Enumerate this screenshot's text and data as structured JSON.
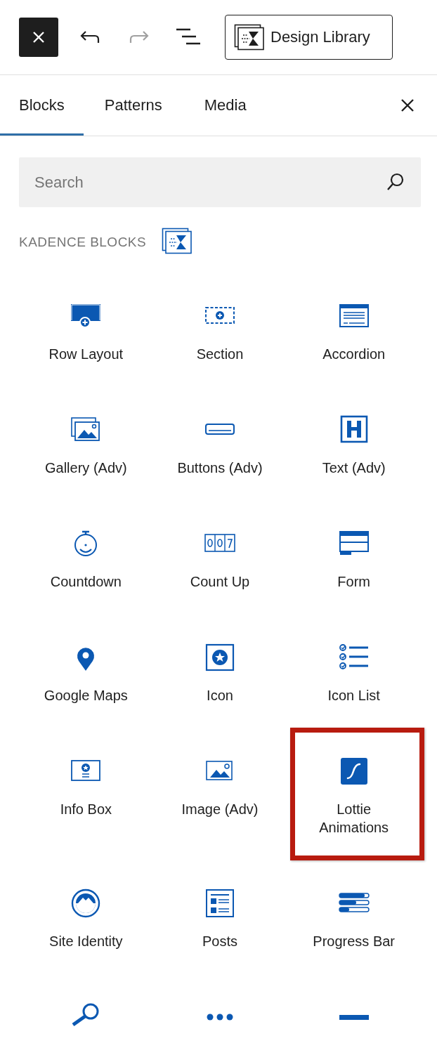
{
  "toolbar": {
    "redo_disabled": true,
    "design_library": "Design Library"
  },
  "tabs": [
    {
      "label": "Blocks",
      "selected": true
    },
    {
      "label": "Patterns",
      "selected": false
    },
    {
      "label": "Media",
      "selected": false
    }
  ],
  "search": {
    "placeholder": "Search"
  },
  "category": {
    "title": "KADENCE BLOCKS"
  },
  "blocks": [
    {
      "kind": "row",
      "label": "Row Layout",
      "highlighted": false
    },
    {
      "kind": "section",
      "label": "Section",
      "highlighted": false
    },
    {
      "kind": "accordion",
      "label": "Accordion",
      "highlighted": false
    },
    {
      "kind": "gallery",
      "label": "Gallery (Adv)",
      "highlighted": false
    },
    {
      "kind": "buttons",
      "label": "Buttons (Adv)",
      "highlighted": false
    },
    {
      "kind": "text",
      "label": "Text (Adv)",
      "highlighted": false
    },
    {
      "kind": "countdown",
      "label": "Countdown",
      "highlighted": false
    },
    {
      "kind": "countup",
      "label": "Count Up",
      "highlighted": false
    },
    {
      "kind": "form",
      "label": "Form",
      "highlighted": false
    },
    {
      "kind": "map",
      "label": "Google Maps",
      "highlighted": false
    },
    {
      "kind": "icon",
      "label": "Icon",
      "highlighted": false
    },
    {
      "kind": "iconlist",
      "label": "Icon List",
      "highlighted": false
    },
    {
      "kind": "infobox",
      "label": "Info Box",
      "highlighted": false
    },
    {
      "kind": "image",
      "label": "Image (Adv)",
      "highlighted": false
    },
    {
      "kind": "lottie",
      "label": "Lottie Animations",
      "highlighted": true
    },
    {
      "kind": "identity",
      "label": "Site Identity",
      "highlighted": false
    },
    {
      "kind": "posts",
      "label": "Posts",
      "highlighted": false
    },
    {
      "kind": "progress",
      "label": "Progress Bar",
      "highlighted": false
    },
    {
      "kind": "search",
      "highlighted": false
    },
    {
      "kind": "dots",
      "highlighted": false
    },
    {
      "kind": "separator",
      "highlighted": false
    }
  ]
}
